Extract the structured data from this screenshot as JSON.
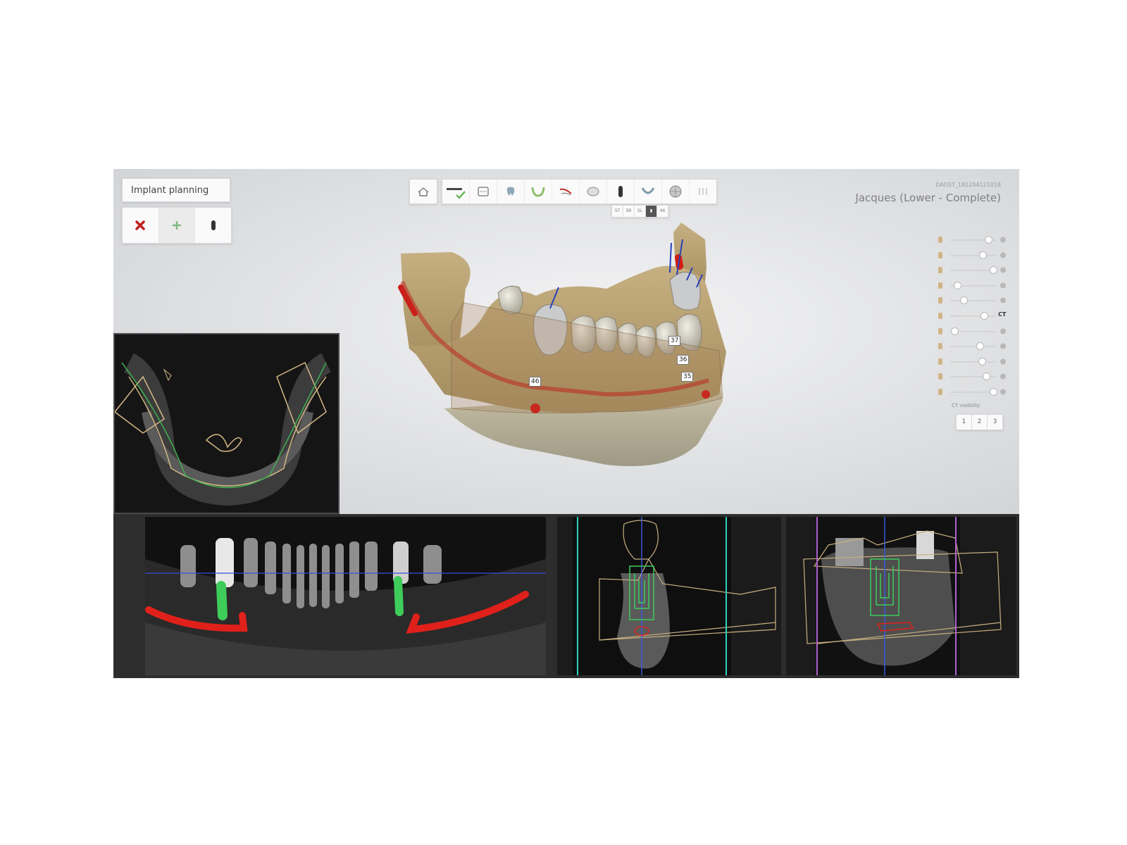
{
  "mode_panel": {
    "title": "Implant planning",
    "tools": [
      {
        "icon": "delete-x-icon",
        "color": "#c0201c"
      },
      {
        "icon": "add-plus-icon",
        "color": "#7fb87f",
        "active": true
      },
      {
        "icon": "implant-icon",
        "color": "#333333"
      }
    ]
  },
  "toolbar": {
    "home_icon": "home-icon",
    "buttons": [
      "ruler-check-icon",
      "scan-icon",
      "tooth-scan-icon",
      "arch-icon",
      "nerve-icon",
      "tooth-crown-icon",
      "implant-icon",
      "jaw-icon",
      "sphere-icon",
      "sleeve-icon"
    ]
  },
  "subbar": {
    "items": [
      "ST",
      "SR",
      "SL",
      "▮",
      "46"
    ],
    "selected_index": 3
  },
  "patient": {
    "id": "DAOST_181204121018",
    "name": "Jacques (Lower - Complete)"
  },
  "visibility_panel": {
    "layers": [
      {
        "icon": "implant-lead-icon",
        "level": 0.85
      },
      {
        "icon": "crown-icon",
        "level": 0.72
      },
      {
        "icon": "nerve-icon",
        "level": 0.95
      },
      {
        "icon": "model-icon",
        "level": 0.15
      },
      {
        "icon": "pin-icon",
        "level": 0.3
      },
      {
        "icon": "ct-icon",
        "level": 0.75,
        "tail_label": "CT"
      },
      {
        "icon": "tooth-icon",
        "level": 0.1
      },
      {
        "icon": "bone-icon",
        "level": 0.65
      },
      {
        "icon": "teeth-icon",
        "level": 0.7
      },
      {
        "icon": "gear-icon",
        "level": 0.8
      },
      {
        "icon": "contrast-icon",
        "level": 0.95
      }
    ],
    "ct_visibility": "CT visibility",
    "view_buttons": [
      "1",
      "2",
      "3"
    ]
  },
  "tooth_labels": [
    "46",
    "37",
    "36",
    "35"
  ]
}
